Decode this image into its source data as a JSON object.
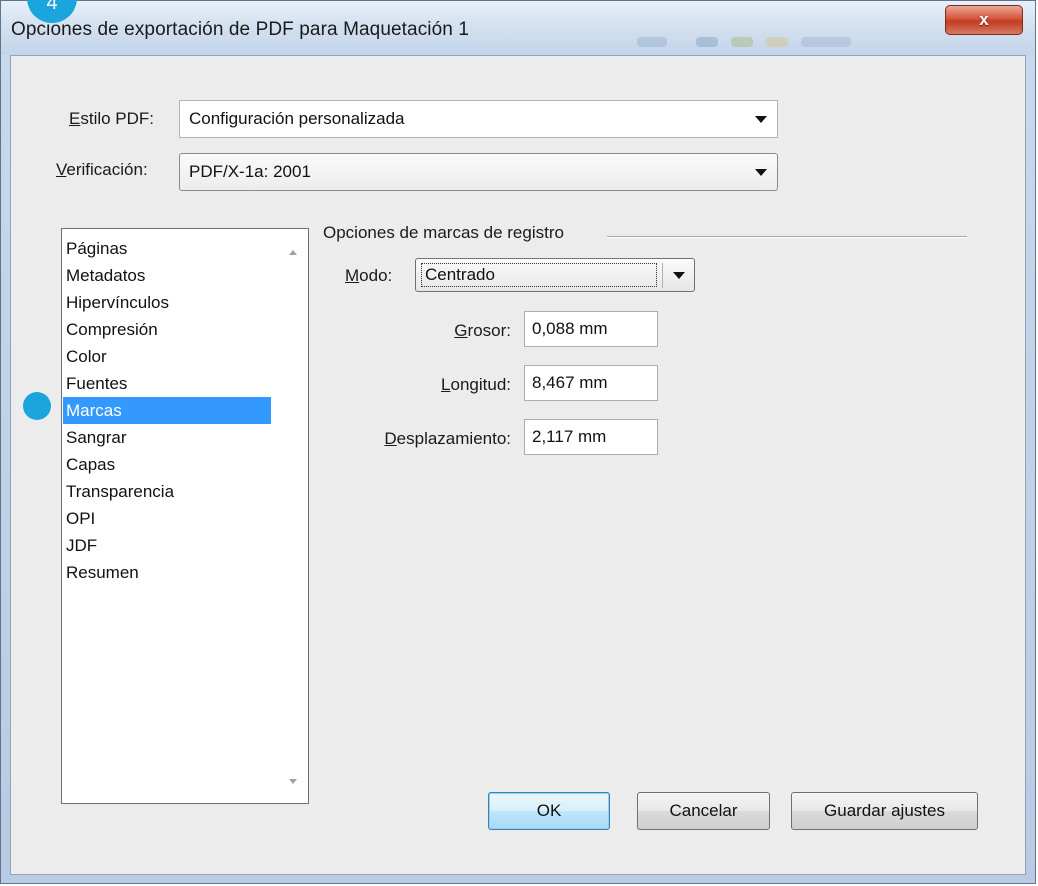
{
  "badge": {
    "number": "4"
  },
  "window": {
    "title": "Opciones de exportación de PDF para Maquetación 1",
    "close_label": "x"
  },
  "header": {
    "style_label": {
      "underlined": "E",
      "rest": "stilo PDF:"
    },
    "style_value": "Configuración personalizada",
    "verification_label": {
      "underlined": "V",
      "rest": "erificación:"
    },
    "verification_value": "PDF/X-1a: 2001"
  },
  "sidebar": {
    "items": [
      "Páginas",
      "Metadatos",
      "Hipervínculos",
      "Compresión",
      "Color",
      "Fuentes",
      "Marcas",
      "Sangrar",
      "Capas",
      "Transparencia",
      "OPI",
      "JDF",
      "Resumen"
    ],
    "selected": "Marcas"
  },
  "panel": {
    "group_title": "Opciones de marcas de registro",
    "mode_label": {
      "underlined": "M",
      "rest": "odo:"
    },
    "mode_value": "Centrado",
    "thickness_label": {
      "underlined": "G",
      "rest": "rosor:"
    },
    "thickness_value": "0,088 mm",
    "length_label": {
      "underlined": "L",
      "rest": "ongitud:"
    },
    "length_value": "8,467 mm",
    "offset_label": {
      "underlined": "D",
      "rest": "esplazamiento:"
    },
    "offset_value": "2,117 mm"
  },
  "buttons": {
    "ok": "OK",
    "cancel": "Cancelar",
    "save": "Guardar ajustes"
  },
  "colors": {
    "selection": "#3399ff",
    "badge": "#1aa5dd",
    "close": "#c23a21"
  }
}
